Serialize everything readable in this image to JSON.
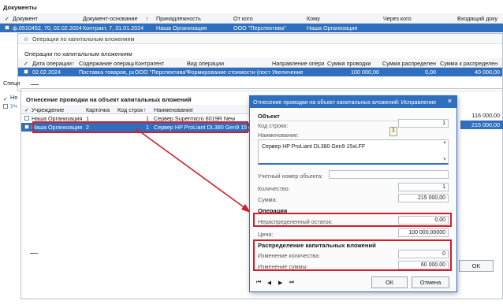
{
  "docs": {
    "title": "Документы",
    "columns": [
      "Документ",
      "Документ-основание",
      "Принадлежность",
      "От кого",
      "Кому",
      "Через кого",
      "Входящий доку"
    ],
    "check_header": "✓",
    "row": {
      "doc": "ф.0510452, 70, 02.02.2024",
      "basis": "Контракт, 7, 31.01.2024",
      "owner": "Наша Организация",
      "from": "ООО \"Перспектива\"",
      "to": "Наша Организация"
    }
  },
  "ops_window": {
    "title": "Операции по капитальным вложениям",
    "panel_title": "Операции по капитальным вложениям",
    "columns": [
      "Дата операции",
      "Содержание операци",
      "Контрагент",
      "Вид операции",
      "Направление операци",
      "Сумма проводки",
      "Сумма распределено",
      "Сумма к распределен"
    ],
    "row": {
      "date": "02.02.2024",
      "content": "Поставка товаров, ра",
      "counterparty": "ООО \"Перспектива\"",
      "kind": "Формирование стоимости (поступ",
      "direction": "Увеличение",
      "amount": "100 000,00",
      "distributed": "0,00",
      "to_distribute": "40 000,00"
    }
  },
  "spec": {
    "label": "Специ",
    "items": [
      "Но",
      "Уч"
    ]
  },
  "attr_panel": {
    "title": "Отнесение проводки на объект капитальных вложений",
    "columns": [
      "Учреждение",
      "Карточка",
      "Код строк",
      "Наименование"
    ],
    "rows": [
      {
        "org": "Наша Организация",
        "card": "1",
        "code": "1",
        "name": "Сервер Supermicro 6019R New"
      },
      {
        "org": "Наша Организация",
        "card": "2",
        "code": "1",
        "name": "Сервер HP ProLiant DL380 Gen9 15xLFF"
      }
    ],
    "right_values": [
      "116 000,00",
      "215 000,00"
    ],
    "ok_label": "OK"
  },
  "dialog": {
    "title": "Отнесение проводки на объект капитальных вложений: Исправление",
    "close_glyph": "✕",
    "object_section": "Объект",
    "row_code_label": "Код строки:",
    "row_code_value": "1",
    "tooltip_value": "1",
    "name_label": "Наименование:",
    "name_value": "Сервер HP ProLiant DL380 Gen9 15xLFF",
    "account_label": "Учетный номер объекта:",
    "account_value": "",
    "qty_label": "Количество:",
    "qty_value": "1",
    "sum_label": "Сумма:",
    "sum_value": "215 000,00",
    "operation_section": "Операция",
    "residual_label": "Нераспределенный остаток:",
    "residual_value": "0,00",
    "price_label": "Цена:",
    "price_value": "100 000,00000",
    "distribution_section": "Распределение капитальных вложений",
    "qty_change_label": "Изменение количества:",
    "qty_change_value": "0",
    "sum_change_label": "Изменение суммы:",
    "sum_change_value": "60 000,00",
    "ok_label": "ОК",
    "cancel_label": "Отмена",
    "nav_glyphs": [
      "⏮",
      "◀",
      "▶",
      "⏭"
    ]
  },
  "colors": {
    "selection": "#2f6fbf",
    "highlight": "#d21f2b",
    "dialog_title": "#2f6fbf"
  }
}
